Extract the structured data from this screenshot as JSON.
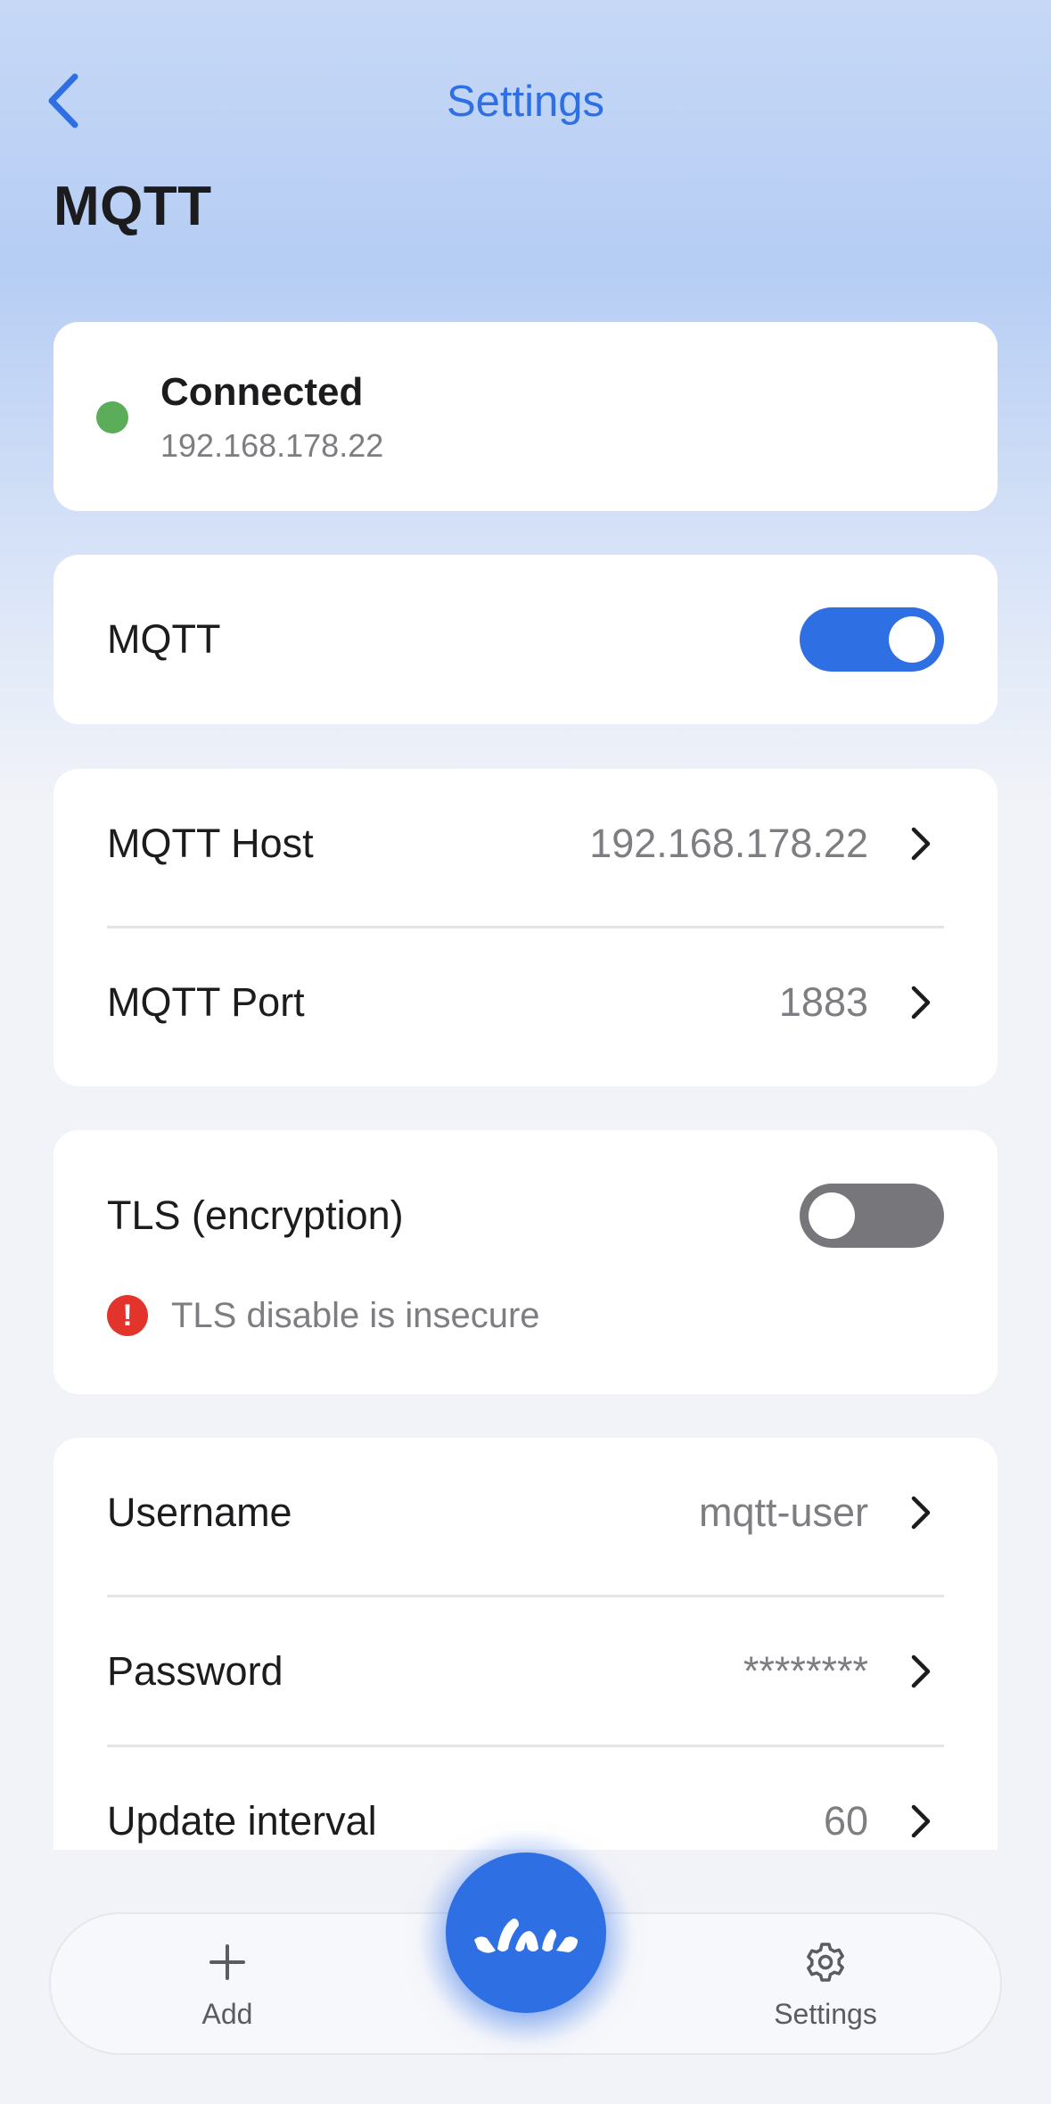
{
  "nav": {
    "back_label": "",
    "title": "Settings"
  },
  "page": {
    "title": "MQTT"
  },
  "status": {
    "title": "Connected",
    "address": "192.168.178.22",
    "color": "#5cad5a"
  },
  "mqtt_toggle": {
    "label": "MQTT",
    "enabled": true
  },
  "connection": {
    "host_label": "MQTT Host",
    "host_value": "192.168.178.22",
    "port_label": "MQTT Port",
    "port_value": "1883"
  },
  "tls": {
    "label": "TLS (encryption)",
    "enabled": false,
    "warning": "TLS disable is insecure",
    "warning_icon": "!"
  },
  "credentials": {
    "username_label": "Username",
    "username_value": "mqtt-user",
    "password_label": "Password",
    "password_value": "********",
    "interval_label": "Update interval",
    "interval_value": "60"
  },
  "tabbar": {
    "add_label": "Add",
    "add_icon": "plus-icon",
    "settings_label": "Settings",
    "settings_icon": "gear-icon",
    "center_icon": "app-logo-icon"
  },
  "colors": {
    "accent": "#2f6fe4",
    "toggle_off": "#77777b",
    "warning": "#e2342a"
  }
}
